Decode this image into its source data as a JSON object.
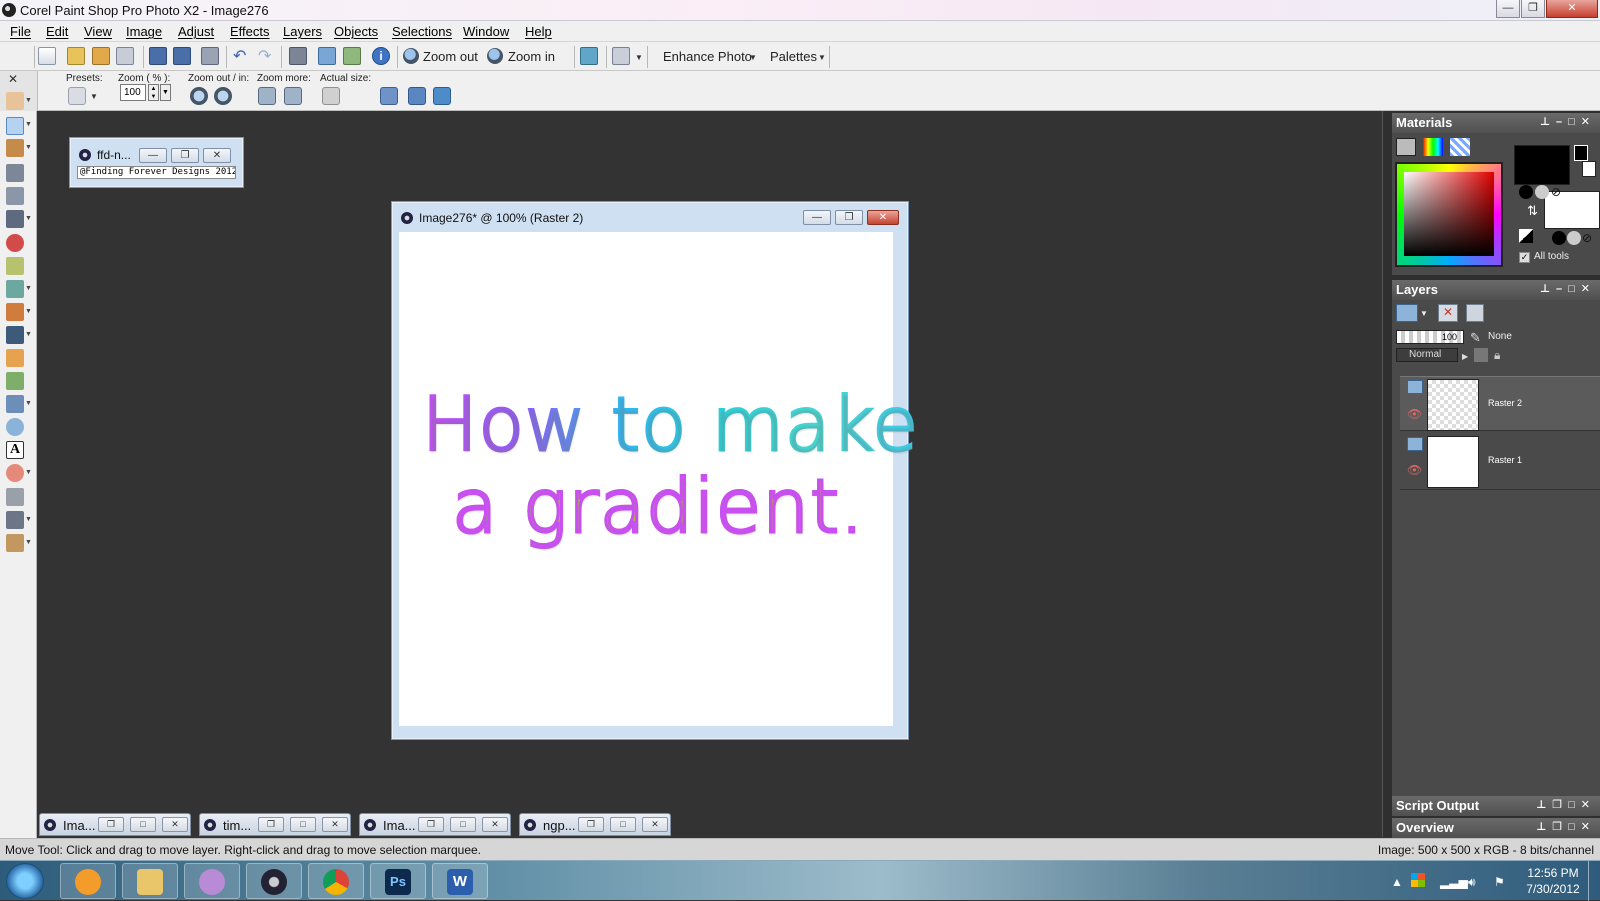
{
  "window": {
    "title": "Corel Paint Shop Pro Photo X2 - Image276",
    "minimize": "—",
    "restore": "❐",
    "close": "✕"
  },
  "menu": [
    "File",
    "Edit",
    "View",
    "Image",
    "Adjust",
    "Effects",
    "Layers",
    "Objects",
    "Selections",
    "Window",
    "Help"
  ],
  "toolbar": {
    "zoom_out": "Zoom out",
    "zoom_in": "Zoom in",
    "enhance_photo": "Enhance Photo",
    "palettes": "Palettes"
  },
  "options": {
    "presets": "Presets:",
    "zoom_pct": "Zoom ( % ):",
    "zoom_value": "100",
    "zoom_out_in": "Zoom out / in:",
    "zoom_more": "Zoom more:",
    "actual_size": "Actual size:"
  },
  "small_window": {
    "title": "ffd-n...",
    "text": "@Finding Forever Designs 2012"
  },
  "doc_window": {
    "title": "Image276* @ 100% (Raster 2)",
    "art_line1": "How to make",
    "art_line2": "a gradient."
  },
  "tabs": [
    {
      "label": "Ima..."
    },
    {
      "label": "tim..."
    },
    {
      "label": "Ima..."
    },
    {
      "label": "ngp..."
    }
  ],
  "materials": {
    "title": "Materials",
    "all_tools": "All tools"
  },
  "layers": {
    "title": "Layers",
    "opacity": "100",
    "blend": "Normal",
    "mask": "None",
    "items": [
      {
        "name": "Raster 2"
      },
      {
        "name": "Raster 1"
      }
    ]
  },
  "script_output": {
    "title": "Script Output"
  },
  "overview": {
    "title": "Overview"
  },
  "status": {
    "left": "Move Tool: Click and drag to move layer. Right-click and drag to move selection marquee.",
    "right": "Image:  500 x 500 x RGB - 8 bits/channel"
  },
  "clock": {
    "time": "12:56 PM",
    "date": "7/30/2012"
  },
  "colors": {
    "foreground": "#000000",
    "background": "#ffffff",
    "workspace": "#333333"
  }
}
